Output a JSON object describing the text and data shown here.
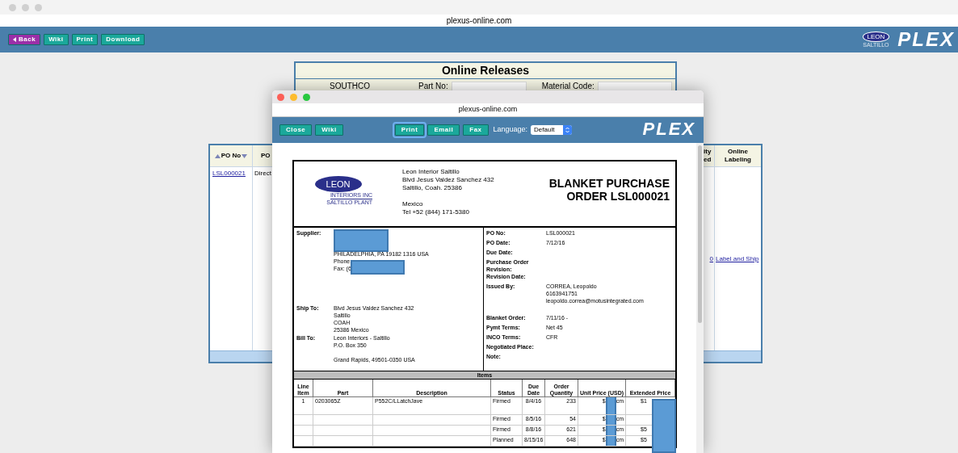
{
  "browser": {
    "url": "plexus-online.com"
  },
  "toolbar": {
    "buttons": [
      {
        "label": "Back",
        "kind": "back"
      },
      {
        "label": "Wiki",
        "kind": "plain"
      },
      {
        "label": "Print",
        "kind": "plain"
      },
      {
        "label": "Download",
        "kind": "plain"
      }
    ]
  },
  "header_logo": {
    "brand": "LEON",
    "subtitle": "SALTILLO",
    "product": "PLEX"
  },
  "releases_panel": {
    "title": "Online Releases",
    "supplier": "SOUTHCO",
    "filters": [
      {
        "label": "Part No:"
      },
      {
        "label": "Material Code:"
      }
    ]
  },
  "releases_table": {
    "left_columns": [
      "PO No",
      "PO"
    ],
    "right_columns": [
      "ity ed",
      "Online Labeling"
    ],
    "rows": [
      {
        "po_no": "LSL000021",
        "po": "Direct",
        "quantity": "0",
        "labeling": "Label and Ship"
      }
    ]
  },
  "popup": {
    "url": "plexus-online.com",
    "buttons": [
      {
        "label": "Close",
        "focused": false
      },
      {
        "label": "Wiki",
        "focused": false
      },
      {
        "label": "Print",
        "focused": true
      },
      {
        "label": "Email",
        "focused": false
      },
      {
        "label": "Fax",
        "focused": false
      }
    ],
    "language": {
      "label": "Language:",
      "value": "Default"
    },
    "product": "PLEX",
    "document": {
      "logo": {
        "brand": "LEON",
        "line1": "INTERIORS INC",
        "line2": "SALTILLO PLANT"
      },
      "company_address": [
        "Leon Interior Saltillo",
        "Blvd Jesus Valdez Sanchez 432",
        "Saltillo, Coah. 25386"
      ],
      "company_contact": [
        "Mexico",
        "Tel +52 (844) 171-5380"
      ],
      "title": [
        "BLANKET PURCHASE",
        "ORDER LSL000021"
      ],
      "supplier": {
        "label": "Supplier:",
        "lines": [
          "PHILADELPHIA, PA 19182 1316 USA"
        ],
        "phone": "Phone:",
        "fax": "Fax: (6"
      },
      "ship_to": {
        "label": "Ship To:",
        "lines": [
          "Blvd Jesus Valdez Sanchez 432",
          "Saltillo",
          "COAH",
          "25386 Mexico"
        ]
      },
      "bill_to": {
        "label": "Bill To:",
        "lines": [
          "Leon Interiors - Saltillo",
          "P.O. Box 350"
        ],
        "city": "Grand Rapids,  49501-0350 USA"
      },
      "details": [
        {
          "label": "PO No:",
          "lines": [
            "LSL000021"
          ]
        },
        {
          "label": "PO Date:",
          "lines": [
            "7/12/16"
          ]
        },
        {
          "label": "Due Date:"
        },
        {
          "label": "Purchase Order Revision:"
        },
        {
          "label": "Revision Date:"
        },
        {
          "label": "Issued By:",
          "lines": [
            "CORREA, Leopoldo",
            "6163941751",
            "leopoldo.correa@motusintegrated.com"
          ]
        },
        {
          "label": "Blanket Order:",
          "lines": [
            "7/11/16 -"
          ]
        },
        {
          "label": "Pymt Terms:",
          "lines": [
            "Net 45"
          ]
        },
        {
          "label": "INCO Terms:",
          "lines": [
            "CFR"
          ]
        },
        {
          "label": "Negotiated Place:"
        },
        {
          "label": "Note:"
        }
      ],
      "items": {
        "title": "Items",
        "columns": [
          "Line Item",
          "Part",
          "Description",
          "Status",
          "Due Date",
          "Order Quantity",
          "Unit Price (USD)",
          "Extended Price"
        ],
        "rows": [
          {
            "line": "1",
            "part": "0203065Z",
            "description": "P552C/LLatchJave",
            "status": "Firmed",
            "due": "8/4/16",
            "qty": "233",
            "unit_a": "$",
            "unit_b": "cm",
            "ext": "$1"
          },
          {
            "line": "",
            "part": "",
            "description": "",
            "status": "Firmed",
            "due": "8/5/16",
            "qty": "54",
            "unit_a": "$",
            "unit_b": "cm"
          },
          {
            "line": "",
            "part": "",
            "description": "",
            "status": "Firmed",
            "due": "8/8/16",
            "qty": "621",
            "unit_a": "$",
            "unit_b": "cm",
            "ext": "$5"
          },
          {
            "line": "",
            "part": "",
            "description": "",
            "status": "Planned",
            "due": "8/15/16",
            "qty": "648",
            "unit_a": "$",
            "unit_b": "cm",
            "ext": "$5"
          }
        ]
      }
    }
  }
}
